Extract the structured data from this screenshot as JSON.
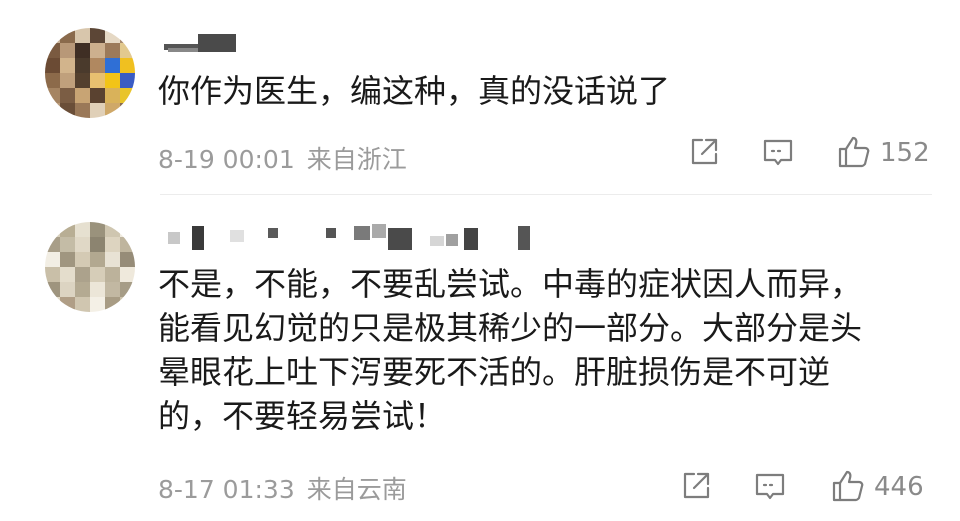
{
  "comments": [
    {
      "text": "你作为医生，编这种，真的没话说了",
      "date": "8-19 00:01",
      "location": "来自浙江",
      "likes": "152"
    },
    {
      "text": "不是，不能，不要乱尝试。中毒的症状因人而异，\n能看见幻觉的只是极其稀少的一部分。大部分是头\n晕眼花上吐下泻要死不活的。肝脏损伤是不可逆\n的，不要轻易尝试！",
      "date": "8-17 01:33",
      "location": "来自云南",
      "likes": "446"
    }
  ],
  "icons": {
    "share": "share-icon",
    "comment": "comment-icon",
    "like": "thumbs-up-icon"
  },
  "colors": {
    "text": "#1a1a1a",
    "meta": "#9b9b9b",
    "icon": "#7d7d7d",
    "divider": "#ececec"
  }
}
